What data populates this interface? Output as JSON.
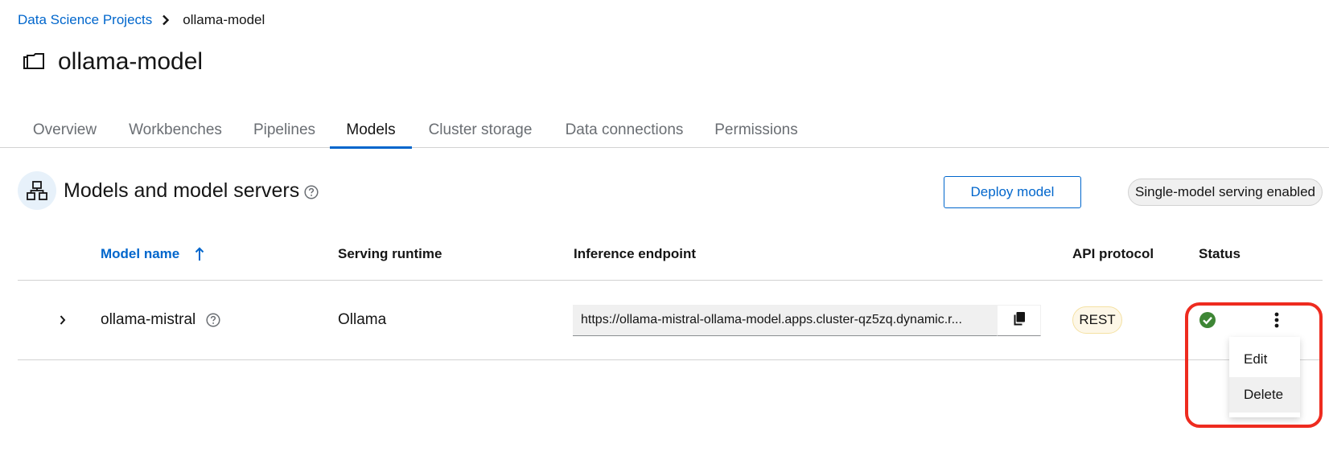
{
  "breadcrumb": {
    "parent": "Data Science Projects",
    "current": "ollama-model"
  },
  "page": {
    "title": "ollama-model"
  },
  "tabs": [
    {
      "label": "Overview",
      "active": false
    },
    {
      "label": "Workbenches",
      "active": false
    },
    {
      "label": "Pipelines",
      "active": false
    },
    {
      "label": "Models",
      "active": true
    },
    {
      "label": "Cluster storage",
      "active": false
    },
    {
      "label": "Data connections",
      "active": false
    },
    {
      "label": "Permissions",
      "active": false
    }
  ],
  "section": {
    "title": "Models and model servers",
    "deploy_label": "Deploy model",
    "serving_badge": "Single-model serving enabled"
  },
  "table": {
    "columns": {
      "model_name": "Model name",
      "serving_runtime": "Serving runtime",
      "inference_endpoint": "Inference endpoint",
      "api_protocol": "API protocol",
      "status": "Status"
    },
    "sort": {
      "column": "Model name",
      "direction": "ascending"
    },
    "rows": [
      {
        "model_name": "ollama-mistral",
        "serving_runtime": "Ollama",
        "inference_endpoint": "https://ollama-mistral-ollama-model.apps.cluster-qz5zq.dynamic.r...",
        "api_protocol": "REST",
        "status": "success"
      }
    ]
  },
  "kebab_menu": {
    "items": [
      "Edit",
      "Delete"
    ],
    "hovered": "Delete"
  },
  "colors": {
    "link": "#0066cc",
    "success": "#3e8635",
    "highlight": "#ee2b1f",
    "rest_label_bg": "#fdf7e7"
  },
  "icons": {
    "project": "folder-icon",
    "section": "model-server-icon",
    "help": "help-icon",
    "sort": "arrow-up-icon",
    "expand": "chevron-right-icon",
    "copy": "copy-icon",
    "status": "check-circle-icon",
    "actions": "kebab-icon"
  }
}
